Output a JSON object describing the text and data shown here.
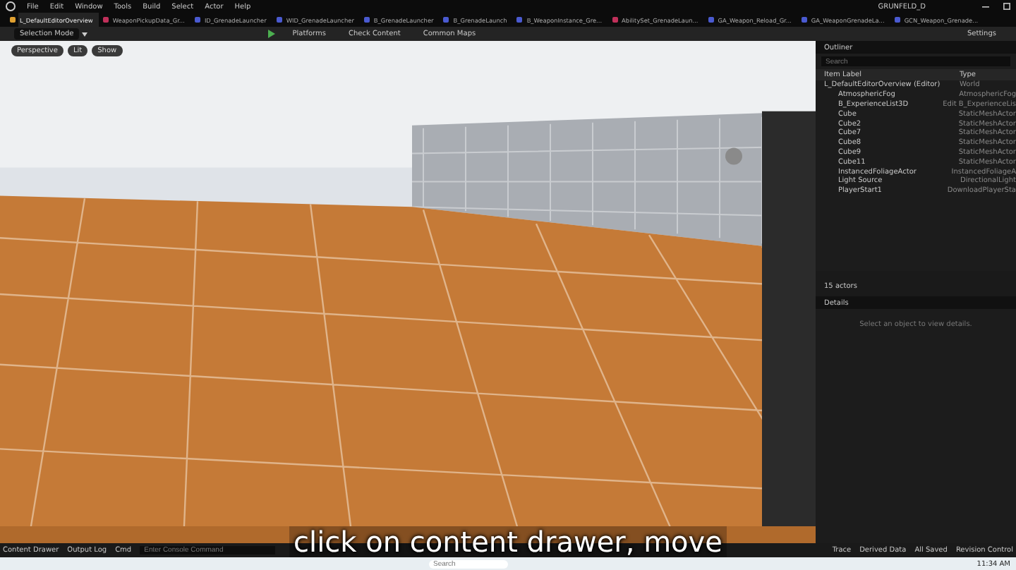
{
  "window": {
    "title": "GRUNFELD_D"
  },
  "menu": [
    "File",
    "Edit",
    "Window",
    "Tools",
    "Build",
    "Select",
    "Actor",
    "Help"
  ],
  "tabs": [
    {
      "label": "L_DefaultEditorOverview",
      "selected": true,
      "color": "#e0a030"
    },
    {
      "label": "WeaponPickupData_Gr...",
      "selected": false,
      "color": "#c0305a"
    },
    {
      "label": "ID_GrenadeLauncher",
      "selected": false,
      "color": "#4a5ad0"
    },
    {
      "label": "WID_GrenadeLauncher",
      "selected": false,
      "color": "#4a5ad0"
    },
    {
      "label": "B_GrenadeLauncher",
      "selected": false,
      "color": "#4a5ad0"
    },
    {
      "label": "B_GrenadeLaunch",
      "selected": false,
      "color": "#4a5ad0"
    },
    {
      "label": "B_WeaponInstance_Gre...",
      "selected": false,
      "color": "#4a5ad0"
    },
    {
      "label": "AbilitySet_GrenadeLaun...",
      "selected": false,
      "color": "#c0305a"
    },
    {
      "label": "GA_Weapon_Reload_Gr...",
      "selected": false,
      "color": "#4a5ad0"
    },
    {
      "label": "GA_WeaponGrenadeLa...",
      "selected": false,
      "color": "#4a5ad0"
    },
    {
      "label": "GCN_Weapon_Grenade...",
      "selected": false,
      "color": "#4a5ad0"
    }
  ],
  "toolbar": {
    "mode": "Selection Mode",
    "items": [
      "Platforms",
      "Check Content",
      "Common Maps"
    ],
    "settings": "Settings"
  },
  "viewport": {
    "buttons": [
      "Perspective",
      "Lit",
      "Show"
    ]
  },
  "outliner": {
    "title": "Outliner",
    "search": {
      "placeholder": "Search"
    },
    "columns": [
      "Item Label",
      "Type"
    ],
    "rows": [
      {
        "label": "L_DefaultEditorOverview (Editor)",
        "type": "World",
        "children": [
          {
            "label": "AtmosphericFog",
            "type": "AtmosphericFog"
          },
          {
            "label": "B_ExperienceList3D",
            "type": "Edit B_ExperienceLis"
          },
          {
            "label": "Cube",
            "type": "StaticMeshActor"
          },
          {
            "label": "Cube2",
            "type": "StaticMeshActor"
          },
          {
            "label": "Cube7",
            "type": "StaticMeshActor"
          },
          {
            "label": "Cube8",
            "type": "StaticMeshActor"
          },
          {
            "label": "Cube9",
            "type": "StaticMeshActor"
          },
          {
            "label": "Cube11",
            "type": "StaticMeshActor"
          },
          {
            "label": "InstancedFoliageActor",
            "type": "InstancedFoliageA"
          },
          {
            "label": "Light Source",
            "type": "DirectionalLight"
          },
          {
            "label": "PlayerStart1",
            "type": "DownloadPlayerSta"
          }
        ]
      }
    ],
    "count": "15 actors"
  },
  "details": {
    "title": "Details",
    "hint": "Select an object to view details."
  },
  "bottom_bar": {
    "left": [
      "Content Drawer",
      "Output Log",
      "Cmd"
    ],
    "console": {
      "placeholder": "Enter Console Command"
    },
    "right": [
      "Trace",
      "Derived Data",
      "All Saved",
      "Revision Control"
    ]
  },
  "caption": "click on content drawer, move",
  "taskbar": {
    "search": {
      "placeholder": "Search"
    },
    "time": "11:34 AM"
  }
}
